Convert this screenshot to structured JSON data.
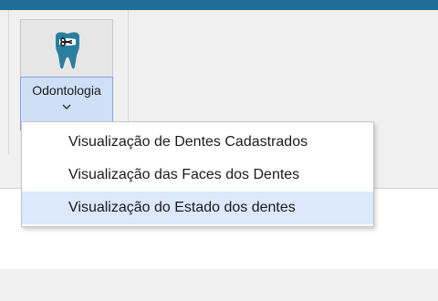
{
  "ribbon": {
    "odontologia_button": {
      "label": "Odontologia",
      "icon": "tooth-icon"
    }
  },
  "dropdown": {
    "items": [
      {
        "label": "Visualização de Dentes Cadastrados"
      },
      {
        "label": "Visualização das Faces dos Dentes"
      },
      {
        "label": "Visualização do Estado dos dentes"
      }
    ],
    "hovered_index": 2
  },
  "colors": {
    "title_strip": "#1f6e97",
    "tooth_fill": "#2a7f9e",
    "button_label_bg": "#cfe0f6",
    "menu_hover": "#dce8fb"
  }
}
